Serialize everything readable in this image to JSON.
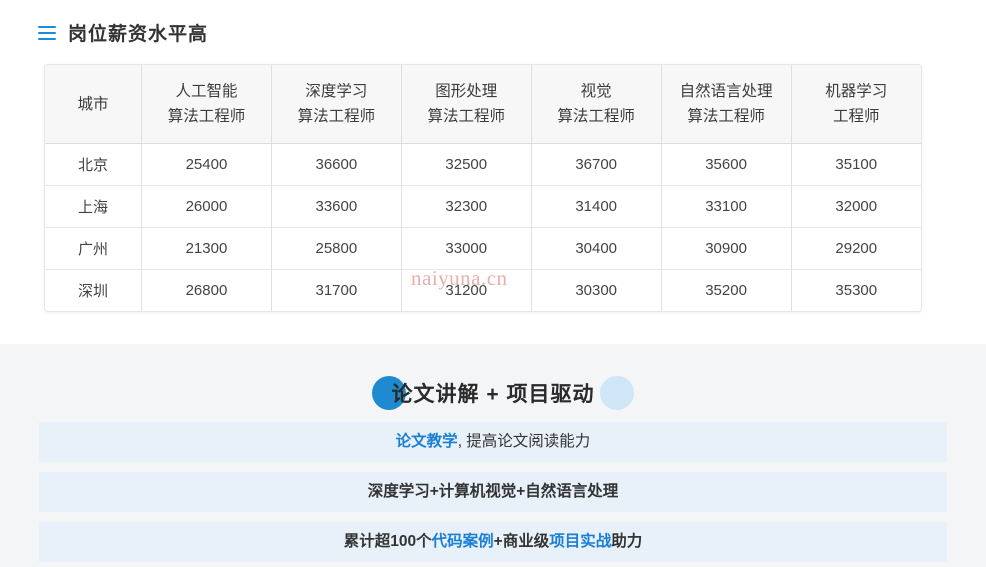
{
  "section": {
    "icon": "menu-bars-icon",
    "title": "岗位薪资水平高"
  },
  "table": {
    "headers": [
      "城市",
      "人工智能\n算法工程师",
      "深度学习\n算法工程师",
      "图形处理\n算法工程师",
      "视觉\n算法工程师",
      "自然语言处理\n算法工程师",
      "机器学习\n工程师"
    ],
    "rows": [
      {
        "city": "北京",
        "values": [
          "25400",
          "36600",
          "32500",
          "36700",
          "35600",
          "35100"
        ]
      },
      {
        "city": "上海",
        "values": [
          "26000",
          "33600",
          "32300",
          "31400",
          "33100",
          "32000"
        ]
      },
      {
        "city": "广州",
        "values": [
          "21300",
          "25800",
          "33000",
          "30400",
          "30900",
          "29200"
        ]
      },
      {
        "city": "深圳",
        "values": [
          "26800",
          "31700",
          "31200",
          "30300",
          "35200",
          "35300"
        ]
      }
    ]
  },
  "watermark": "naiyuna.cn",
  "panel": {
    "title": "论文讲解 + 项目驱动",
    "bullets": [
      {
        "highlight": "论文教学",
        "rest": ", 提高论文阅读能力",
        "prefix": ""
      },
      {
        "highlight": "",
        "rest": "",
        "prefix": "深度学习+计算机视觉+自然语言处理"
      },
      {
        "prefix": "累计超100个",
        "highlight": "代码案例",
        "mid": "+商业级",
        "highlight2": "项目实战",
        "rest": "助力"
      }
    ]
  },
  "colors": {
    "accent": "#1a7fd4",
    "panel_bg": "#f4f5f7",
    "row_bg": "#e8f1fa",
    "watermark": "#e8aaa8"
  }
}
